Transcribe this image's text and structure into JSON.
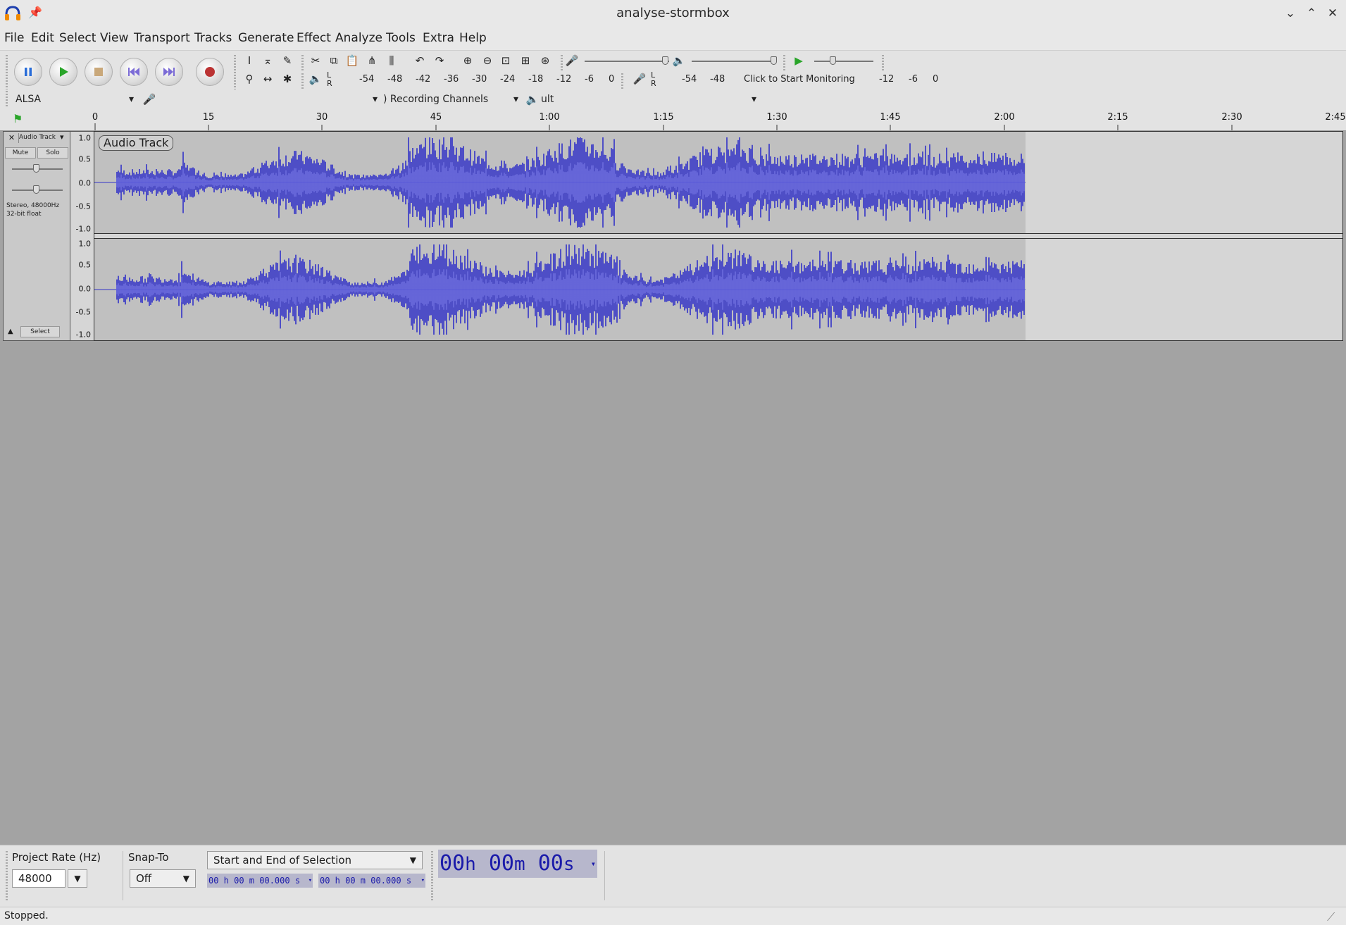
{
  "window": {
    "title": "analyse-stormbox"
  },
  "menu": [
    "File",
    "Edit",
    "Select",
    "View",
    "Transport",
    "Tracks",
    "Generate",
    "Effect",
    "Analyze",
    "Tools",
    "Extra",
    "Help"
  ],
  "meters": {
    "playback_ticks": [
      "-54",
      "-48",
      "-42",
      "-36",
      "-30",
      "-24",
      "-18",
      "-12",
      "-6",
      "0"
    ],
    "record_ticks": [
      "-54",
      "-48",
      "-12",
      "-6",
      "0"
    ],
    "record_hint": "Click to Start Monitoring",
    "lr_l": "L",
    "lr_r": "R"
  },
  "devices": {
    "host": "ALSA",
    "recording_channels": ") Recording Channels",
    "output": "ult"
  },
  "ruler": {
    "labels": [
      "0",
      "15",
      "30",
      "45",
      "1:00",
      "1:15",
      "1:30",
      "1:45",
      "2:00",
      "2:15",
      "2:30",
      "2:45"
    ]
  },
  "track": {
    "name": "Audio Track",
    "clip_label": "Audio Track",
    "mute": "Mute",
    "solo": "Solo",
    "info_line1": "Stereo, 48000Hz",
    "info_line2": "32-bit float",
    "select": "Select",
    "scale": [
      "1.0",
      "0.5",
      "0.0",
      "-0.5",
      "-1.0"
    ]
  },
  "selection_toolbar": {
    "rate_label": "Project Rate (Hz)",
    "rate_value": "48000",
    "snap_label": "Snap-To",
    "snap_value": "Off",
    "selection_mode": "Start and End of Selection",
    "start_time": "00 h 00 m 00.000 s",
    "end_time": "00 h 00 m 00.000 s",
    "big_time": {
      "h": "00",
      "m": "00",
      "s": "00",
      "hu": "h",
      "mu": "m",
      "su": "s"
    }
  },
  "status": "Stopped.",
  "colors": {
    "waveform": "#3232c8",
    "waveform_rms": "#6464dc",
    "clip_bg": "#c0c0c0",
    "track_bg": "#a3a3a3"
  }
}
